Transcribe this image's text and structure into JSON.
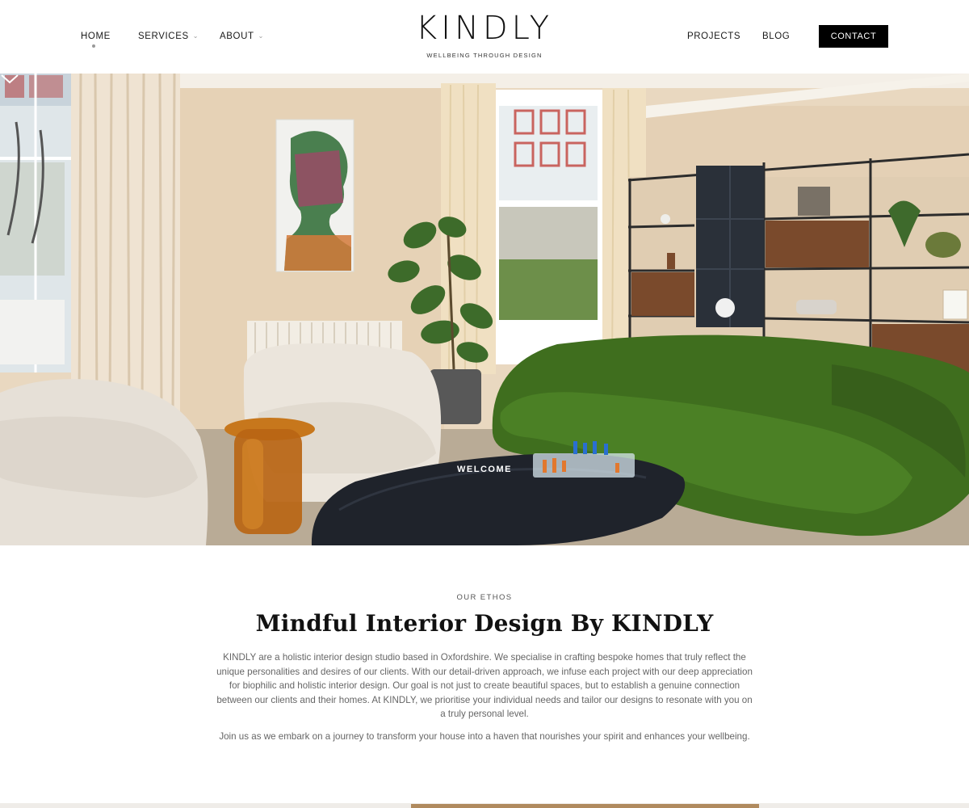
{
  "header": {
    "logo": "KINDLY",
    "tagline": "WELLBEING THROUGH DESIGN",
    "nav_left": [
      {
        "label": "HOME",
        "active": true
      },
      {
        "label": "SERVICES",
        "dropdown": true
      },
      {
        "label": "ABOUT",
        "dropdown": true
      }
    ],
    "nav_right": [
      {
        "label": "PROJECTS"
      },
      {
        "label": "BLOG"
      }
    ],
    "contact_label": "CONTACT"
  },
  "hero": {
    "welcome_label": "WELCOME",
    "scroll_icon": "chevron-down-icon"
  },
  "ethos": {
    "eyebrow": "OUR ETHOS",
    "title": "Mindful Interior Design By KINDLY",
    "paragraph1": "KINDLY are a holistic interior design studio based in Oxfordshire. We specialise in crafting bespoke homes that truly reflect the unique personalities and desires of our clients. With our detail-driven approach, we infuse each project with our deep appreciation for biophilic and holistic interior design. Our goal is not just to create beautiful spaces, but to establish a genuine connection between our clients and their homes. At KINDLY, we prioritise your individual needs and tailor our designs to resonate with you on a truly personal level.",
    "paragraph2": "Join us as we embark on a journey to transform your house into a haven that nourishes your spirit and enhances your wellbeing."
  },
  "colors": {
    "contact_bg": "#000000",
    "sofa_green": "#3f6e1e",
    "wall_beige": "#e8d6bd"
  }
}
